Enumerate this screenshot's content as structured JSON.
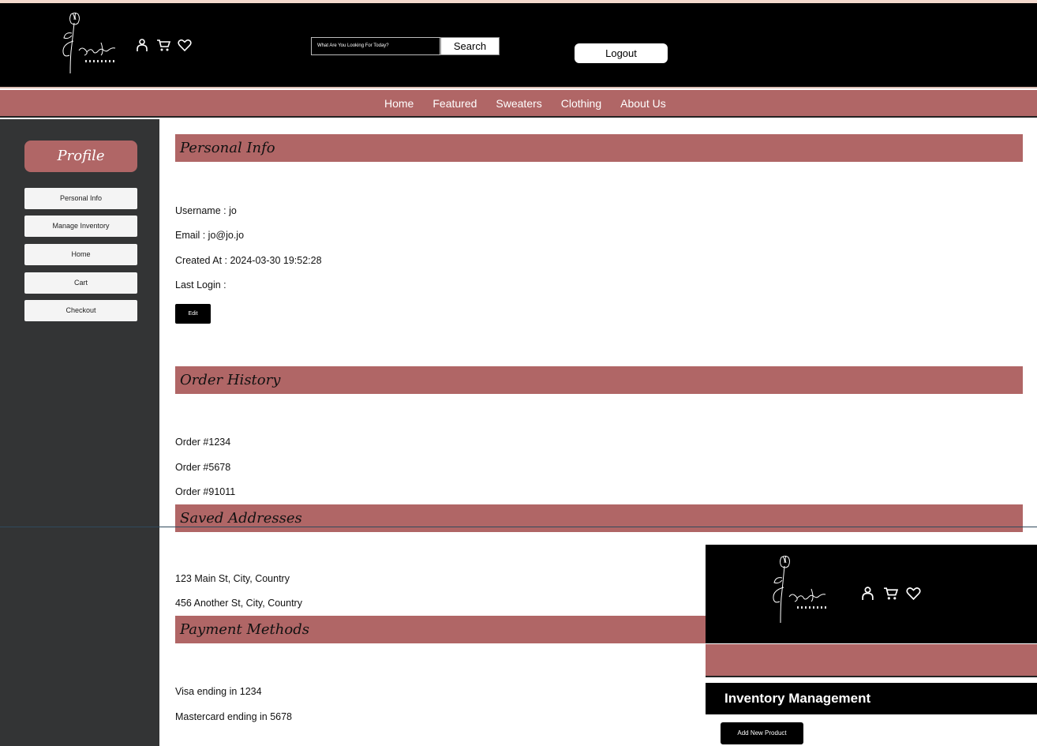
{
  "header": {
    "search_placeholder": "What Are You Looking For Today?",
    "search_label": "Search",
    "logout_label": "Logout"
  },
  "nav": {
    "items": [
      "Home",
      "Featured",
      "Sweaters",
      "Clothing",
      "About Us"
    ]
  },
  "sidebar": {
    "title": "Profile",
    "items": [
      "Personal Info",
      "Manage Inventory",
      "Home",
      "Cart",
      "Checkout"
    ]
  },
  "personal_info": {
    "heading": "Personal Info",
    "username": "Username : jo",
    "email": "Email : jo@jo.jo",
    "created_at": "Created At : 2024-03-30 19:52:28",
    "last_login": "Last Login :",
    "edit_label": "Edit"
  },
  "order_history": {
    "heading": "Order History",
    "orders": [
      "Order #1234",
      "Order #5678",
      "Order #91011"
    ]
  },
  "saved_addresses": {
    "heading": "Saved Addresses",
    "addresses": [
      "123 Main St, City, Country",
      "456 Another St, City, Country"
    ]
  },
  "payment_methods": {
    "heading": "Payment Methods",
    "methods": [
      "Visa ending in 1234",
      "Mastercard ending in 5678"
    ]
  },
  "inventory": {
    "title": "Inventory Management",
    "add_button": "Add New Product"
  },
  "icons": {
    "logo": "rose-logo-icon",
    "user": "user-icon",
    "cart": "cart-icon",
    "wishlist": "heart-icon"
  },
  "colors": {
    "accent": "#b06666",
    "sidebar": "#333435",
    "header": "#000000",
    "backdrop": "#f3d9cd"
  }
}
